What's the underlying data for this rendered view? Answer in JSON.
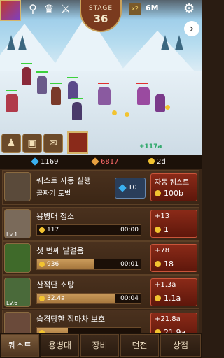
{
  "top": {
    "stage_label": "STAGE",
    "stage_number": "36",
    "speed_badge": "x2",
    "gold_total": "6M",
    "icons": [
      "portrait-icon",
      "ribbon-icon",
      "crown-icon",
      "swords-icon",
      "gear-icon",
      "next-arrow-icon"
    ]
  },
  "battle": {
    "damage_popup": "+117a"
  },
  "resources": {
    "gems": "1169",
    "rubies": "6817",
    "timer": "2d"
  },
  "auto_quest": {
    "title": "퀘스트 자동 실행",
    "subtitle": "골짜기 토벌",
    "gem_cost": "10",
    "button_title": "자동 퀘스트",
    "button_cost": "100b"
  },
  "quests": [
    {
      "name": "용병대 청소",
      "level": "Lv.1",
      "value": "117",
      "time": "00:00",
      "fill": 0.0,
      "upg_top": "+13",
      "upg_cost": "1",
      "thumb": "#7a6a5a"
    },
    {
      "name": "첫 번째 발걸음",
      "level": "",
      "value": "936",
      "time": "00:01",
      "fill": 0.55,
      "upg_top": "+78",
      "upg_cost": "18",
      "thumb": "#3f6a2a"
    },
    {
      "name": "산적단 소탕",
      "level": "Lv.6",
      "value": "32.4a",
      "time": "00:04",
      "fill": 0.75,
      "upg_top": "+1.3a",
      "upg_cost": "1.1a",
      "thumb": "#4a6a3a"
    },
    {
      "name": "습격당한 짐마차 보호",
      "level": "",
      "value": "",
      "time": "",
      "fill": 0.3,
      "upg_top": "+21.8a",
      "upg_cost": "21.9a",
      "thumb": "#6a4a3a"
    }
  ],
  "tabs": [
    "퀘스트",
    "용병대",
    "장비",
    "던전",
    "상점"
  ],
  "colors": {
    "accent": "#c9a15a",
    "upgrade": "#8a2a18",
    "gem": "#3ab0f0",
    "gold": "#f2c330"
  }
}
